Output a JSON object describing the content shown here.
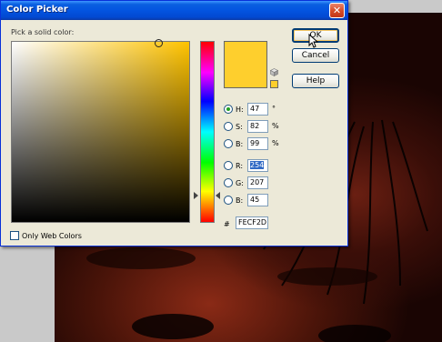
{
  "window": {
    "title": "Color Picker",
    "close_glyph": "✕"
  },
  "picker": {
    "prompt": "Pick a solid color:",
    "selected_color": "#FECF2D",
    "hue_color": "#FFC300"
  },
  "buttons": {
    "ok": "OK",
    "cancel": "Cancel",
    "help": "Help"
  },
  "fields": {
    "h": {
      "label": "H:",
      "value": "47",
      "unit": "°",
      "selected": true
    },
    "s": {
      "label": "S:",
      "value": "82",
      "unit": "%"
    },
    "b": {
      "label": "B:",
      "value": "99",
      "unit": "%"
    },
    "r": {
      "label": "R:",
      "value": "254"
    },
    "g": {
      "label": "G:",
      "value": "207"
    },
    "b2": {
      "label": "B:",
      "value": "45"
    }
  },
  "hex": {
    "label": "#",
    "value": "FECF2D"
  },
  "web_colors": {
    "label": "Only Web Colors",
    "checked": false
  },
  "icons": [
    "close-icon",
    "cube-icon",
    "cursor-icon"
  ]
}
